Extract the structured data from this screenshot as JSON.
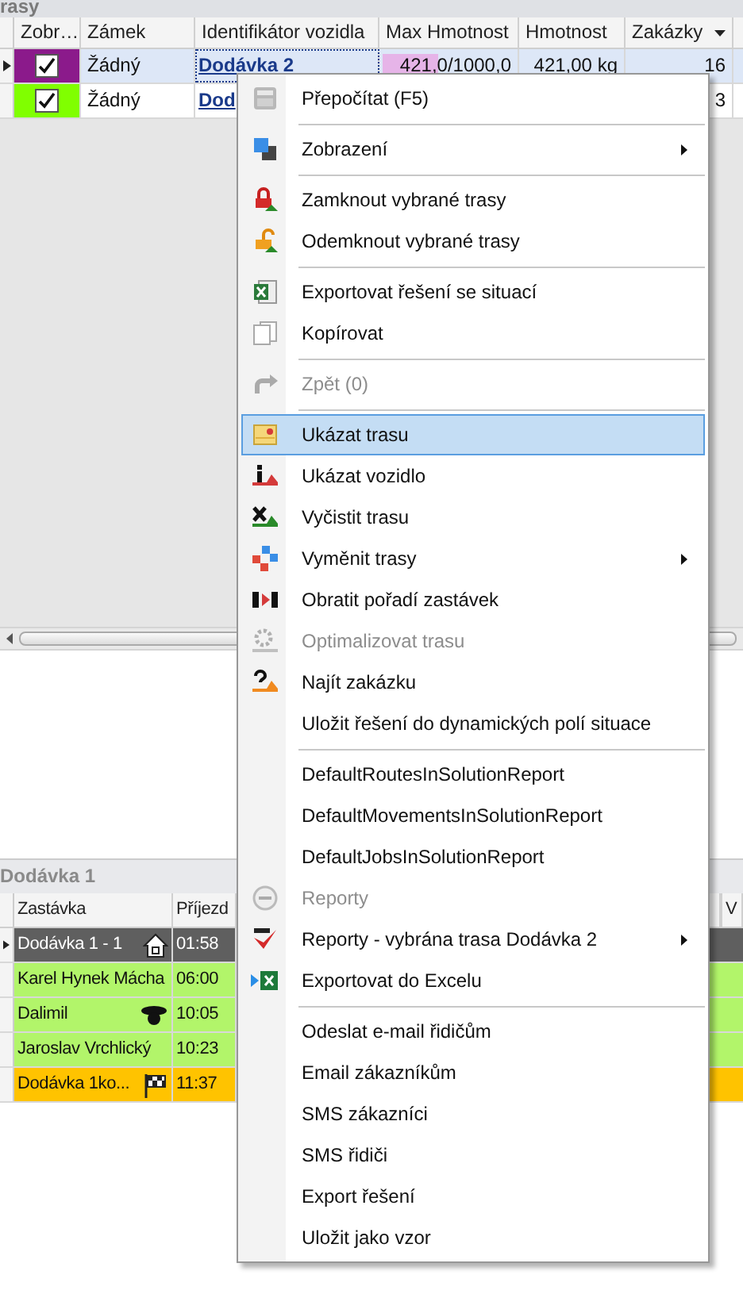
{
  "routes_panel": {
    "title": "rasy",
    "columns": [
      "Zobr…",
      "Zámek",
      "Identifikátor vozidla",
      "Max Hmotnost",
      "Hmotnost",
      "Zakázky"
    ],
    "rows": [
      {
        "selected": true,
        "current": true,
        "color": "#8b1a8b",
        "checked": true,
        "lock": "Žádný",
        "vehicle": "Dodávka 2",
        "max_weight": "421,0/1000,0",
        "level": 0.421,
        "weight": "421,00 kg",
        "orders": "16"
      },
      {
        "selected": false,
        "current": false,
        "color": "#80ff00",
        "checked": true,
        "lock": "Žádný",
        "vehicle": "Dod",
        "orders": "3"
      }
    ]
  },
  "stops_panel": {
    "title": "Dodávka 1",
    "columns": [
      "Zastávka",
      "Příjezd"
    ],
    "last_column": "V",
    "rows": [
      {
        "kind": "start",
        "current": true,
        "color": "#5f5f5f",
        "stop": "Dodávka 1 - 1",
        "arrival": "01:58"
      },
      {
        "kind": "stop",
        "current": false,
        "color": "#b2f56a",
        "stop": "Karel Hynek Mácha",
        "arrival": "06:00"
      },
      {
        "kind": "marked",
        "current": false,
        "color": "#b2f56a",
        "stop": "Dalimil",
        "arrival": "10:05"
      },
      {
        "kind": "stop",
        "current": false,
        "color": "#b2f56a",
        "stop": "Jaroslav Vrchlický",
        "arrival": "10:23"
      },
      {
        "kind": "end",
        "current": false,
        "color": "#ffc300",
        "stop": "Dodávka 1ko...",
        "arrival": "11:37"
      }
    ]
  },
  "context_menu": [
    {
      "kind": "item",
      "label": "Přepočítat (F5)",
      "disabled": false,
      "selected": false,
      "submenu": false
    },
    {
      "kind": "separator"
    },
    {
      "kind": "item",
      "label": "Zobrazení",
      "disabled": false,
      "selected": false,
      "submenu": true
    },
    {
      "kind": "separator"
    },
    {
      "kind": "item",
      "label": "Zamknout vybrané trasy",
      "disabled": false,
      "selected": false,
      "submenu": false
    },
    {
      "kind": "item",
      "label": "Odemknout vybrané trasy",
      "disabled": false,
      "selected": false,
      "submenu": false
    },
    {
      "kind": "separator"
    },
    {
      "kind": "item",
      "label": "Exportovat řešení se situací",
      "disabled": false,
      "selected": false,
      "submenu": false
    },
    {
      "kind": "item",
      "label": "Kopírovat",
      "disabled": false,
      "selected": false,
      "submenu": false
    },
    {
      "kind": "separator"
    },
    {
      "kind": "item",
      "label": "Zpět (0)",
      "disabled": true,
      "selected": false,
      "submenu": false
    },
    {
      "kind": "separator"
    },
    {
      "kind": "item",
      "label": "Ukázat trasu",
      "disabled": false,
      "selected": true,
      "submenu": false
    },
    {
      "kind": "item",
      "label": "Ukázat vozidlo",
      "disabled": false,
      "selected": false,
      "submenu": false
    },
    {
      "kind": "item",
      "label": "Vyčistit trasu",
      "disabled": false,
      "selected": false,
      "submenu": false
    },
    {
      "kind": "item",
      "label": "Vyměnit trasy",
      "disabled": false,
      "selected": false,
      "submenu": true
    },
    {
      "kind": "item",
      "label": "Obratit pořadí zastávek",
      "disabled": false,
      "selected": false,
      "submenu": false
    },
    {
      "kind": "item",
      "label": "Optimalizovat trasu",
      "disabled": true,
      "selected": false,
      "submenu": false
    },
    {
      "kind": "item",
      "label": "Najít zakázku",
      "disabled": false,
      "selected": false,
      "submenu": false
    },
    {
      "kind": "item",
      "label": "Uložit řešení do dynamických polí situace",
      "disabled": false,
      "selected": false,
      "submenu": false
    },
    {
      "kind": "separator"
    },
    {
      "kind": "item",
      "label": "DefaultRoutesInSolutionReport",
      "disabled": false,
      "selected": false,
      "submenu": false
    },
    {
      "kind": "item",
      "label": "DefaultMovementsInSolutionReport",
      "disabled": false,
      "selected": false,
      "submenu": false
    },
    {
      "kind": "item",
      "label": "DefaultJobsInSolutionReport",
      "disabled": false,
      "selected": false,
      "submenu": false
    },
    {
      "kind": "item",
      "label": "Reporty",
      "disabled": true,
      "selected": false,
      "submenu": false
    },
    {
      "kind": "item",
      "label": "Reporty - vybrána trasa Dodávka 2",
      "disabled": false,
      "selected": false,
      "submenu": true
    },
    {
      "kind": "item",
      "label": "Exportovat do Excelu",
      "disabled": false,
      "selected": false,
      "submenu": false
    },
    {
      "kind": "separator"
    },
    {
      "kind": "item",
      "label": "Odeslat e-mail řidičům",
      "disabled": false,
      "selected": false,
      "submenu": false
    },
    {
      "kind": "item",
      "label": "Email zákazníkům",
      "disabled": false,
      "selected": false,
      "submenu": false
    },
    {
      "kind": "item",
      "label": "SMS zákazníci",
      "disabled": false,
      "selected": false,
      "submenu": false
    },
    {
      "kind": "item",
      "label": "SMS řidiči",
      "disabled": false,
      "selected": false,
      "submenu": false
    },
    {
      "kind": "item",
      "label": "Export řešení",
      "disabled": false,
      "selected": false,
      "submenu": false
    },
    {
      "kind": "item",
      "label": "Uložit jako vzor",
      "disabled": false,
      "selected": false,
      "submenu": false
    }
  ]
}
